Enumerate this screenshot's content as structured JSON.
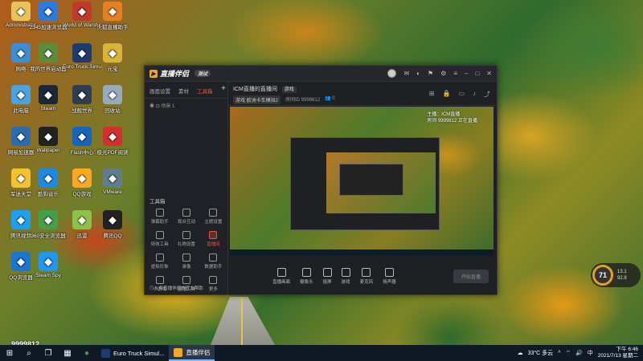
{
  "desktop": {
    "icons": [
      {
        "label": "Administrator",
        "icon": "folder-icon",
        "color": "#e8c25a"
      },
      {
        "label": "2345加速浏览器",
        "icon": "browser-icon",
        "color": "#2a7be4"
      },
      {
        "label": "World of Warships",
        "icon": "warships-icon",
        "color": "#c0392b"
      },
      {
        "label": "火狐直播助手",
        "icon": "fox-icon",
        "color": "#e67e22"
      },
      {
        "label": "网络",
        "icon": "network-icon",
        "color": "#3a8fd9"
      },
      {
        "label": "我的世界启动器",
        "icon": "minecraft-icon",
        "color": "#5a8f3a"
      },
      {
        "label": "Euro Truck Simulator 2",
        "icon": "truck-icon",
        "color": "#1e3b70"
      },
      {
        "label": "元宝",
        "icon": "yuanbao-icon",
        "color": "#d9b43a"
      },
      {
        "label": "此电脑",
        "icon": "computer-icon",
        "color": "#4aa3df"
      },
      {
        "label": "Steam",
        "icon": "steam-icon",
        "color": "#1b2838"
      },
      {
        "label": "战舰世界",
        "icon": "warship-icon",
        "color": "#2c3e50"
      },
      {
        "label": "回收站",
        "icon": "recycle-bin-icon",
        "color": "#9ab"
      },
      {
        "label": "网易加速器",
        "icon": "accelerator-icon",
        "color": "#2b6cb0"
      },
      {
        "label": "Wallpaper",
        "icon": "wallpaper-icon",
        "color": "#222"
      },
      {
        "label": "Flash中心",
        "icon": "flash-icon",
        "color": "#1565c0"
      },
      {
        "label": "极光PDF阅读",
        "icon": "pdf-icon",
        "color": "#d32f2f"
      },
      {
        "label": "军迷天堂",
        "icon": "game-icon",
        "color": "#f2c230"
      },
      {
        "label": "酷狗音乐",
        "icon": "kugou-icon",
        "color": "#1e88e5"
      },
      {
        "label": "QQ游戏",
        "icon": "qq-game-icon",
        "color": "#f9a825"
      },
      {
        "label": "VMware",
        "icon": "vmware-icon",
        "color": "#607d8b"
      },
      {
        "label": "腾讯视频",
        "icon": "tencent-video-icon",
        "color": "#1ea0f2"
      },
      {
        "label": "360安全浏览器",
        "icon": "360-icon",
        "color": "#43a047"
      },
      {
        "label": "迅雷",
        "icon": "thunder-icon",
        "color": "#8bc34a"
      },
      {
        "label": "腾讯QQ",
        "icon": "qq-icon",
        "color": "#222"
      },
      {
        "label": "QQ浏览器",
        "icon": "qq-browser-icon",
        "color": "#1976d2"
      },
      {
        "label": "Steam Spy",
        "icon": "spy-icon",
        "color": "#2196f3"
      }
    ],
    "widget": {
      "percent": "71",
      "line1": "13.1",
      "line2": "92.8"
    },
    "watermark": "9999812"
  },
  "app": {
    "name": "直播伴侣",
    "version_badge": "测试",
    "left_tabs": [
      "画面设置",
      "素材",
      "工具箱"
    ],
    "scene_label": "场景 1",
    "toolbox_title": "工具箱",
    "tools": [
      "弹幕助手",
      "观众互动",
      "主题设置",
      "特效工具",
      "礼物设置",
      "直播间",
      "虚拟形象",
      "录像",
      "数据助手",
      "小游戏",
      "直播工具",
      "更多"
    ],
    "footer_note": "5 条直播伴侣的官方帮助",
    "room_title": "ICM直播的直播间",
    "room_tag": "游戏",
    "room_category": "游戏 欧洲卡车模拟2",
    "room_id": "9999812",
    "room_viewers": "0",
    "preview_text_line1": "主播：ICM直播",
    "preview_text_line2": "房间 9999812 正在直播",
    "controls": [
      "直播画面",
      "摄像头",
      "投屏",
      "游戏",
      "麦克风",
      "扬声器"
    ],
    "start_button": "开始直播"
  },
  "taskbar": {
    "tasks": [
      {
        "label": "Euro Truck Simul...",
        "icon": "truck-icon",
        "active": false
      },
      {
        "label": "直播伴侣",
        "icon": "app-icon",
        "active": true
      }
    ],
    "weather": "33°C 多云",
    "time": "下午 6:46",
    "date": "2021/7/13 星期二"
  }
}
